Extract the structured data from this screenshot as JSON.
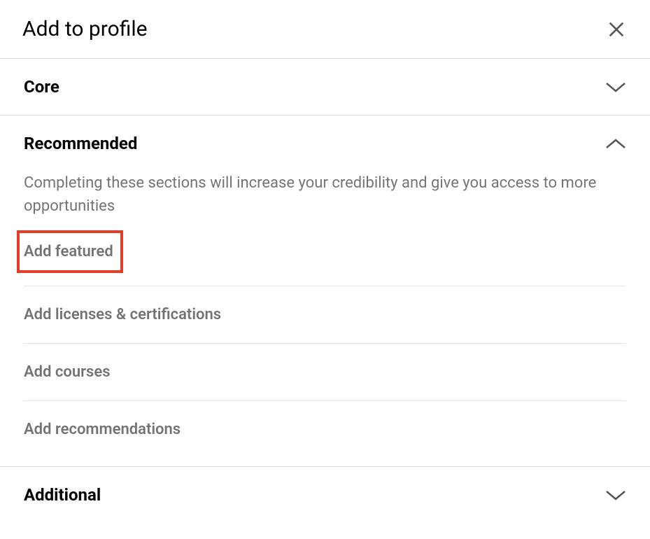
{
  "modal": {
    "title": "Add to profile"
  },
  "sections": {
    "core": {
      "title": "Core"
    },
    "recommended": {
      "title": "Recommended",
      "description": "Completing these sections will increase your credibility and give you access to more opportunities",
      "items": [
        "Add featured",
        "Add licenses & certifications",
        "Add courses",
        "Add recommendations"
      ]
    },
    "additional": {
      "title": "Additional"
    }
  }
}
